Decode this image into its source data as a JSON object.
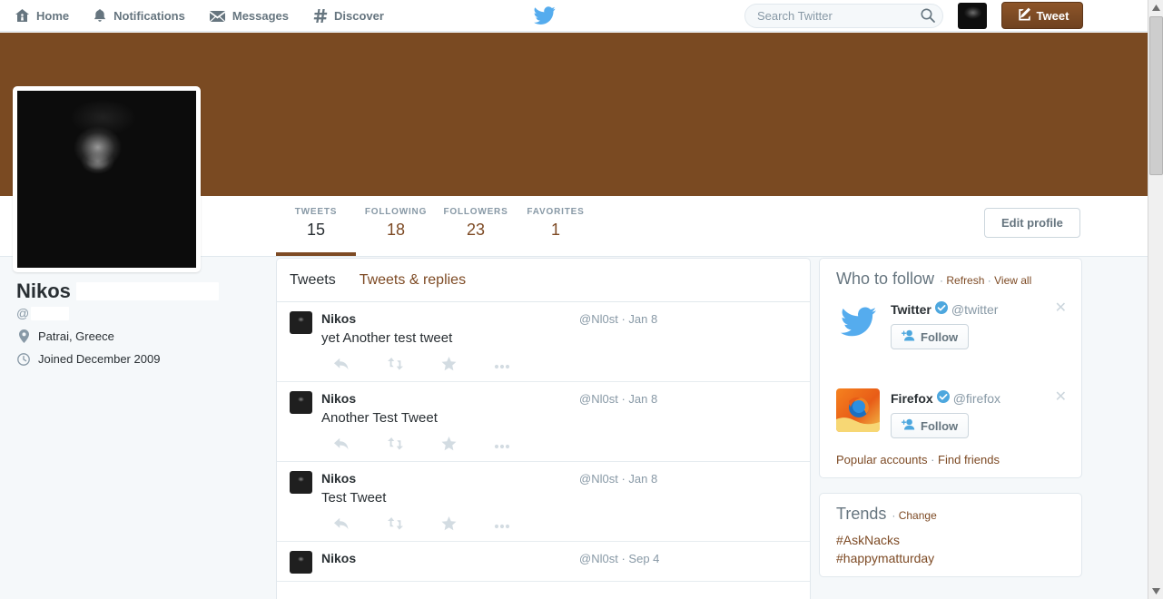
{
  "topnav": {
    "items": [
      {
        "label": "Home",
        "icon": "home-icon"
      },
      {
        "label": "Notifications",
        "icon": "bell-icon"
      },
      {
        "label": "Messages",
        "icon": "envelope-icon"
      },
      {
        "label": "Discover",
        "icon": "hashtag-icon"
      }
    ],
    "logo_icon": "twitter-bird-icon",
    "search": {
      "placeholder": "Search Twitter",
      "value": "",
      "icon": "search-icon"
    },
    "account_avatar_icon": "account-avatar",
    "tweet_button": {
      "label": "Tweet",
      "icon": "compose-icon"
    }
  },
  "theme": {
    "banner_color": "#7a4a22",
    "accent_color": "#7d4a24",
    "link_blue": "#1b95e0",
    "page_bg": "#f5f8fa",
    "verified_blue": "#4da7de"
  },
  "profile": {
    "full_name": "Nikos",
    "name_redacted": true,
    "screen_name_prefix": "@",
    "screen_name_redacted": true,
    "location": "Patrai, Greece",
    "location_icon": "pin-icon",
    "joined": "Joined December 2009",
    "joined_icon": "clock-icon",
    "photo_icon": "profile-photo",
    "edit_profile_label": "Edit profile"
  },
  "stats": [
    {
      "label": "TWEETS",
      "value": "15",
      "active": true
    },
    {
      "label": "FOLLOWING",
      "value": "18",
      "active": false
    },
    {
      "label": "FOLLOWERS",
      "value": "23",
      "active": false
    },
    {
      "label": "FAVORITES",
      "value": "1",
      "active": false
    }
  ],
  "timeline": {
    "tabs": [
      {
        "label": "Tweets",
        "active": true
      },
      {
        "label": "Tweets & replies",
        "active": false
      }
    ],
    "tweets": [
      {
        "name": "Nikos",
        "handle": "@Nl0st",
        "separator": "·",
        "date": "Jan 8",
        "text": "yet Another test tweet",
        "actions": [
          "reply-icon",
          "retweet-icon",
          "favorite-icon",
          "more-icon"
        ]
      },
      {
        "name": "Nikos",
        "handle": "@Nl0st",
        "separator": "·",
        "date": "Jan 8",
        "text": "Another Test Tweet",
        "actions": [
          "reply-icon",
          "retweet-icon",
          "favorite-icon",
          "more-icon"
        ]
      },
      {
        "name": "Nikos",
        "handle": "@Nl0st",
        "separator": "·",
        "date": "Jan 8",
        "text": "Test Tweet",
        "actions": [
          "reply-icon",
          "retweet-icon",
          "favorite-icon",
          "more-icon"
        ]
      },
      {
        "name": "Nikos",
        "handle": "@Nl0st",
        "separator": "·",
        "date": "Sep 4",
        "text": "",
        "actions": []
      }
    ]
  },
  "who_to_follow": {
    "title": "Who to follow",
    "refresh_label": "Refresh",
    "view_all_label": "View all",
    "separator": "·",
    "suggestions": [
      {
        "name": "Twitter",
        "handle": "@twitter",
        "verified": true,
        "follow_label": "Follow",
        "avatar_icon": "twitter-bird-avatar",
        "dismiss_icon": "close-icon"
      },
      {
        "name": "Firefox",
        "handle": "@firefox",
        "verified": true,
        "follow_label": "Follow",
        "avatar_icon": "firefox-avatar",
        "dismiss_icon": "close-icon"
      }
    ],
    "footer": {
      "popular_accounts": "Popular accounts",
      "find_friends": "Find friends",
      "separator": "·"
    }
  },
  "trends": {
    "title": "Trends",
    "change_label": "Change",
    "separator": "·",
    "items": [
      "#AskNacks",
      "#happymatturday"
    ]
  },
  "scrollbar": {
    "up_arrow_icon": "caret-up-icon",
    "down_arrow_icon": "caret-down-icon"
  }
}
